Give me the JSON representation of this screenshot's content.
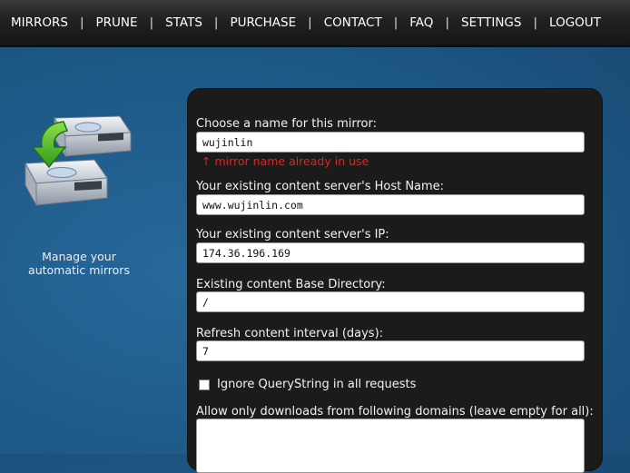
{
  "nav": {
    "items": [
      "MIRRORS",
      "PRUNE",
      "STATS",
      "PURCHASE",
      "CONTACT",
      "FAQ",
      "SETTINGS",
      "LOGOUT"
    ],
    "separator": "|"
  },
  "sidebar": {
    "icon": "mirror-drives-icon",
    "caption": "Manage your automatic mirrors"
  },
  "form": {
    "name_label": "Choose a name for this mirror:",
    "name_value": "wujinlin",
    "name_error": "↑ mirror name already in use",
    "host_label": "Your existing content server's Host Name:",
    "host_value": "www.wujinlin.com",
    "ip_label": "Your existing content server's IP:",
    "ip_value": "174.36.196.169",
    "basedir_label": "Existing content Base Directory:",
    "basedir_value": "/",
    "refresh_label": "Refresh content interval (days):",
    "refresh_value": "7",
    "ignore_qs_label": "Ignore QueryString in all requests",
    "ignore_qs_checked": false,
    "domains_label": "Allow only downloads from following domains (leave empty for all):",
    "domains_value": ""
  },
  "colors": {
    "error": "#e0251d",
    "panel": "#1b1b1b",
    "background": "#1f5b89"
  }
}
